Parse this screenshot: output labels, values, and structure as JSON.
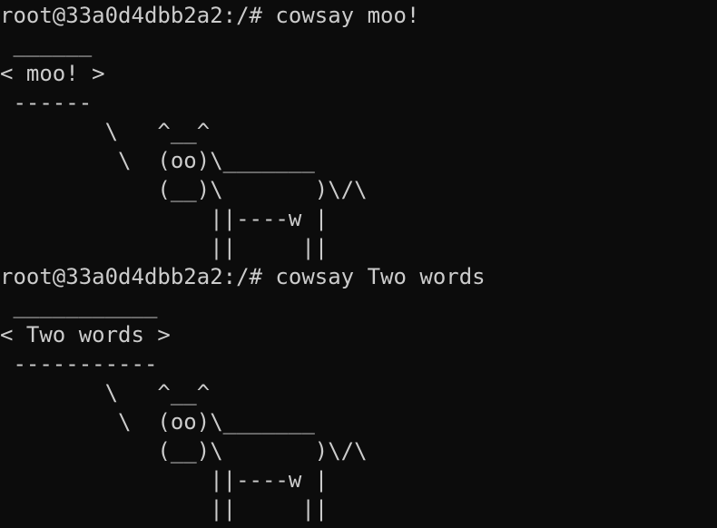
{
  "terminal": {
    "colors": {
      "background": "#0c0c0c",
      "foreground": "#cccccc"
    },
    "lines": [
      "root@33a0d4dbb2a2:/# cowsay moo!",
      " ______",
      "< moo! >",
      " ------",
      "        \\   ^__^",
      "         \\  (oo)\\_______",
      "            (__)\\       )\\/\\",
      "                ||----w |",
      "                ||     ||",
      "root@33a0d4dbb2a2:/# cowsay Two words",
      " ___________",
      "< Two words >",
      " -----------",
      "        \\   ^__^",
      "         \\  (oo)\\_______",
      "            (__)\\       )\\/\\",
      "                ||----w |",
      "                ||     ||"
    ]
  }
}
